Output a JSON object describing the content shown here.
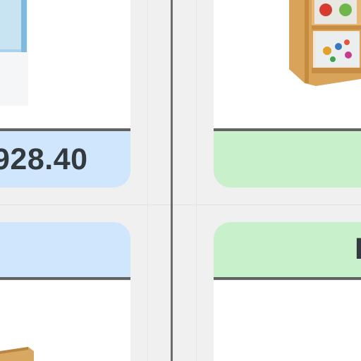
{
  "products": [
    {
      "id_label": "left",
      "price_text": "928.40",
      "accent": "#d0e6fd"
    },
    {
      "id_label": "right",
      "price_text": "",
      "accent": "#c8f0ca",
      "lower_label_fragment": "I"
    }
  ],
  "colors": {
    "divider": "#6b6b6b",
    "rule": "#626262",
    "blue_tag": "#d0e6fd",
    "green_tag": "#c8f0ca",
    "page_bg": "#f0f0f0"
  }
}
